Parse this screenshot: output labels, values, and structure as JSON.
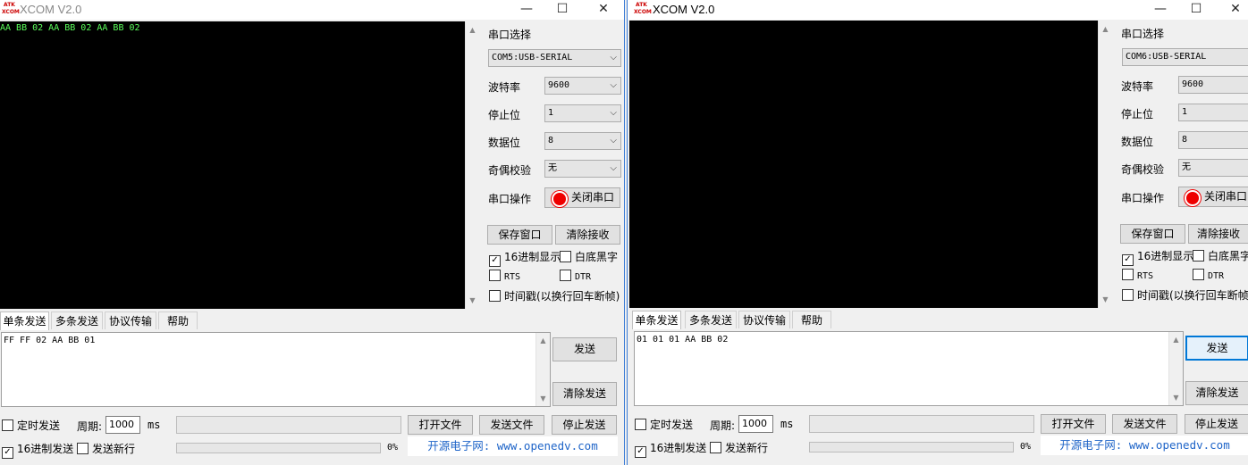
{
  "left": {
    "title": "XCOM V2.0",
    "logo": [
      "ATK",
      "XCOM"
    ],
    "received": "AA BB 02 AA BB 02 AA BB 02",
    "port_label": "串口选择",
    "port_value": "COM5:USB-SERIAL",
    "baud_label": "波特率",
    "baud_value": "9600",
    "stop_label": "停止位",
    "stop_value": "1",
    "data_label": "数据位",
    "data_value": "8",
    "parity_label": "奇偶校验",
    "parity_value": "无",
    "op_label": "串口操作",
    "op_button": "关闭串口",
    "save_window": "保存窗口",
    "clear_receive": "清除接收",
    "hex_display": "16进制显示",
    "hex_display_checked": true,
    "white_bg": "白底黑字",
    "white_bg_checked": false,
    "rts": "RTS",
    "dtr": "DTR",
    "timestamp": "时间戳(以换行回车断帧)",
    "tabs": [
      "单条发送",
      "多条发送",
      "协议传输",
      "帮助"
    ],
    "active_tab": 0,
    "send_text": "FF FF 02 AA BB 01",
    "send_button": "发送",
    "clear_send": "清除发送",
    "timed_send": "定时发送",
    "period_label": "周期:",
    "period_value": "1000",
    "ms": "ms",
    "open_file": "打开文件",
    "send_file": "发送文件",
    "stop_send": "停止发送",
    "hex_send": "16进制发送",
    "hex_send_checked": true,
    "send_newline": "发送新行",
    "progress": "0%",
    "progress_value": 0,
    "url": "开源电子网: www.openedv.com"
  },
  "right": {
    "title": "XCOM V2.0",
    "logo": [
      "ATK",
      "XCOM"
    ],
    "received": "",
    "port_label": "串口选择",
    "port_value": "COM6:USB-SERIAL",
    "baud_label": "波特率",
    "baud_value": "9600",
    "stop_label": "停止位",
    "stop_value": "1",
    "data_label": "数据位",
    "data_value": "8",
    "parity_label": "奇偶校验",
    "parity_value": "无",
    "op_label": "串口操作",
    "op_button": "关闭串口",
    "save_window": "保存窗口",
    "clear_receive": "清除接收",
    "hex_display": "16进制显示",
    "hex_display_checked": true,
    "white_bg": "白底黑字",
    "white_bg_checked": false,
    "rts": "RTS",
    "dtr": "DTR",
    "timestamp": "时间戳(以换行回车断帧)",
    "tabs": [
      "单条发送",
      "多条发送",
      "协议传输",
      "帮助"
    ],
    "active_tab": 0,
    "send_text": "01 01 01 AA BB 02",
    "send_button": "发送",
    "clear_send": "清除发送",
    "timed_send": "定时发送",
    "period_label": "周期:",
    "period_value": "1000",
    "ms": "ms",
    "open_file": "打开文件",
    "send_file": "发送文件",
    "stop_send": "停止发送",
    "hex_send": "16进制发送",
    "hex_send_checked": true,
    "send_newline": "发送新行",
    "progress": "0%",
    "progress_value": 0,
    "url": "开源电子网: www.openedv.com"
  },
  "colors": {
    "receive_bg": "#000000",
    "receive_text": "#5cff5c",
    "url_text": "#1e64c8",
    "close_port_icon": "#e00000"
  },
  "icons": {
    "minimize": "minimize-icon",
    "maximize": "maximize-icon",
    "close": "close-icon",
    "dropdown": "chevron-down-icon",
    "port_state": "red-dot-icon"
  }
}
